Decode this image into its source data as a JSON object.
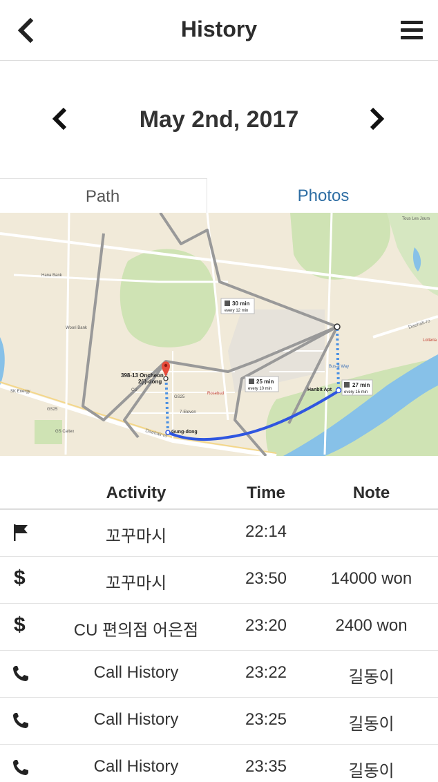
{
  "header": {
    "title": "History",
    "back_icon": "chevron-left-icon",
    "menu_icon": "hamburger-menu-icon"
  },
  "date_nav": {
    "date": "May 2nd, 2017",
    "prev_icon": "chevron-left-icon",
    "next_icon": "chevron-right-icon"
  },
  "tabs": [
    {
      "label": "Path",
      "active": false
    },
    {
      "label": "Photos",
      "active": true,
      "color": "#2d6da3"
    }
  ],
  "map": {
    "labels": {
      "address": "398-13 Oncheon\n2(i)-dong",
      "gung_dong": "Gung-dong",
      "hanbit_apt": "Hanbit Apt",
      "bus1_time": "30 min",
      "bus1_freq": "every 12 min",
      "bus2_time": "25 min",
      "bus2_freq": "every 10 min",
      "bus3_time": "27 min",
      "bus3_freq": "every 15 min",
      "daehak_ro": "Daehak-ro",
      "cu": "CU",
      "gs25": "GS25",
      "seven_eleven": "7-Eleven",
      "rosebud": "Rosebud",
      "hana_bank": "Hana Bank",
      "woori_bank": "Woori Bank",
      "sk_energy": "SK Energy",
      "gs_caltex": "GS Caltex",
      "tous_les_jours": "Tous Les Jours",
      "lotteria": "Lotteria",
      "bus_way": "Bus-e Way"
    }
  },
  "table": {
    "headers": {
      "activity": "Activity",
      "time": "Time",
      "note": "Note"
    },
    "rows": [
      {
        "icon": "flag-icon",
        "activity": "꼬꾸마시",
        "time": "22:14",
        "note": ""
      },
      {
        "icon": "dollar-icon",
        "activity": "꼬꾸마시",
        "time": "23:50",
        "note": "14000 won"
      },
      {
        "icon": "dollar-icon",
        "activity": "CU 편의점 어은점",
        "time": "23:20",
        "note": "2400 won"
      },
      {
        "icon": "phone-icon",
        "activity": "Call History",
        "time": "23:22",
        "note": "길동이"
      },
      {
        "icon": "phone-icon",
        "activity": "Call History",
        "time": "23:25",
        "note": "길동이"
      },
      {
        "icon": "phone-icon",
        "activity": "Call History",
        "time": "23:35",
        "note": "길동이"
      }
    ]
  }
}
